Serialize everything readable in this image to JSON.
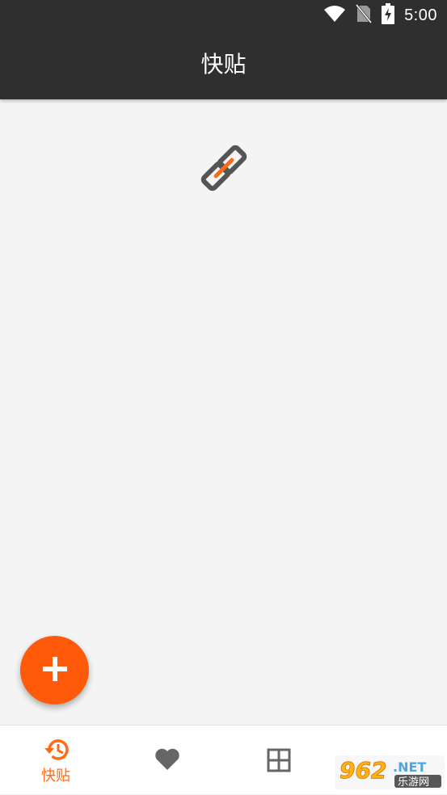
{
  "status_bar": {
    "time": "5:00",
    "icons": [
      "wifi-icon",
      "no-sim-icon",
      "battery-charging-icon"
    ]
  },
  "app_bar": {
    "title": "快贴"
  },
  "content": {
    "empty_icon": "link-icon"
  },
  "fab": {
    "icon": "plus-icon",
    "color": "#ff5a0a"
  },
  "bottom_nav": {
    "items": [
      {
        "icon": "history-icon",
        "label": "快贴",
        "active": true
      },
      {
        "icon": "heart-icon",
        "label": "",
        "active": false
      },
      {
        "icon": "grid-icon",
        "label": "",
        "active": false
      },
      {
        "icon": "",
        "label": "",
        "active": false
      }
    ],
    "active_color": "#ff6a14",
    "inactive_color": "#666666"
  },
  "watermark": {
    "text": "962.NET 乐游网"
  },
  "colors": {
    "toolbar": "#2f2f2f",
    "background": "#f4f4f4",
    "accent": "#ff5a0a"
  }
}
